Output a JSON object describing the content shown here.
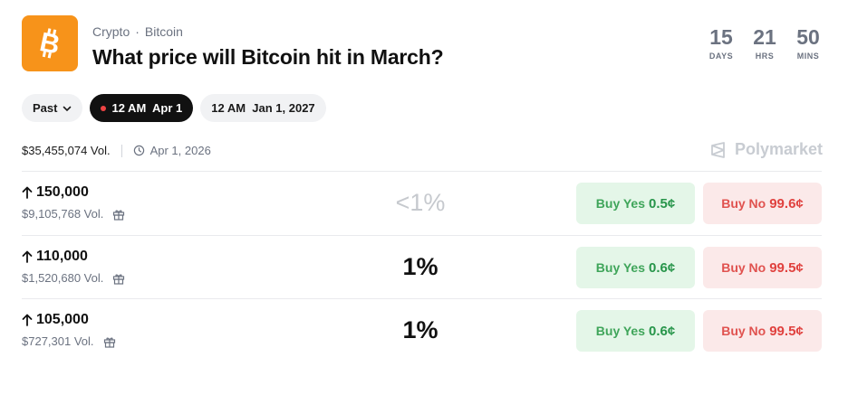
{
  "header": {
    "logo_icon": "bitcoin-icon",
    "logo_color": "#f7931a",
    "breadcrumb": [
      "Crypto",
      "Bitcoin"
    ],
    "breadcrumb_sep": "·",
    "title": "What price will Bitcoin hit in March?"
  },
  "countdown": [
    {
      "value": "15",
      "label": "DAYS"
    },
    {
      "value": "21",
      "label": "HRS"
    },
    {
      "value": "50",
      "label": "MINS"
    }
  ],
  "filters": {
    "past_label": "Past",
    "active_label": "12 AM  Apr 1",
    "other_label": "12 AM  Jan 1, 2027"
  },
  "meta": {
    "volume": "$35,455,074 Vol.",
    "date": "Apr 1, 2026",
    "brand": "Polymarket"
  },
  "outcomes": [
    {
      "label": "150,000",
      "volume": "$9,105,768 Vol.",
      "pct": "<1%",
      "yes_label": "Buy Yes",
      "yes_price": "0.5¢",
      "no_label": "Buy No",
      "no_price": "99.6¢"
    },
    {
      "label": "110,000",
      "volume": "$1,520,680 Vol.",
      "pct": "1%",
      "yes_label": "Buy Yes",
      "yes_price": "0.6¢",
      "no_label": "Buy No",
      "no_price": "99.5¢"
    },
    {
      "label": "105,000",
      "volume": "$727,301 Vol.",
      "pct": "1%",
      "yes_label": "Buy Yes",
      "yes_price": "0.6¢",
      "no_label": "Buy No",
      "no_price": "99.5¢"
    }
  ],
  "colors": {
    "yes_bg": "#e4f6e8",
    "yes_text": "#3fa55a",
    "no_bg": "#fbe9e9",
    "no_text": "#e0524f",
    "active_pill": "#111111",
    "live_dot": "#ef4444"
  }
}
